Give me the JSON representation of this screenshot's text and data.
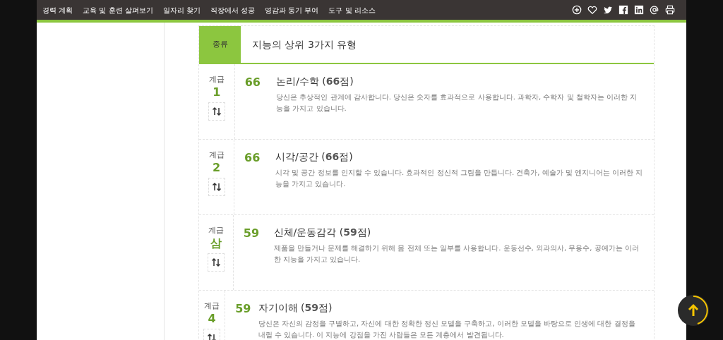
{
  "nav": {
    "items": [
      "경력 계획",
      "교육 및 훈련 살펴보기",
      "일자리 찾기",
      "직장에서 성공",
      "영감과 동기 부여",
      "도구 및 리소스"
    ],
    "icons": [
      {
        "kind": "add"
      },
      {
        "kind": "heart"
      },
      {
        "kind": "twitter"
      },
      {
        "kind": "facebook"
      },
      {
        "kind": "linkedin"
      },
      {
        "kind": "email"
      },
      {
        "kind": "print"
      }
    ]
  },
  "table": {
    "header": {
      "column_1": "종류",
      "column_2": "지능의 상위 3가지 유형"
    },
    "rows": [
      {
        "rank_label": "계급",
        "rank": "1",
        "score": "66",
        "title": "논리/수학 (**66**점)",
        "description": "당신은 추상적인 관계에 감사합니다. 당신은 숫자를 효과적으로 사용합니다. 과학자, 수학자 및 철학자는 이러한 지능을 가지고 있습니다."
      },
      {
        "rank_label": "계급",
        "rank": "2",
        "score": "66",
        "title": "시각/공간 (**66**점)",
        "description": "시각 및 공간 정보를 인지할 수 있습니다. 효과적인 정신적 그림을 만듭니다. 건축가, 예술가 및 엔지니어는 이러한 지능을 가지고 있습니다."
      },
      {
        "rank_label": "계급",
        "rank": "삼",
        "score": "59",
        "title": "신체/운동감각 (**59**점)",
        "description": "제품을 만들거나 문제를 해결하기 위해 몸 전체 또는 일부를 사용합니다. 운동선수, 외과의사, 무용수, 공예가는 이러한 지능을 가지고 있습니다."
      },
      {
        "rank_label": "계급",
        "rank": "4",
        "score": "59",
        "title": "자기이해 (**59**점)",
        "description": "당신은 자신의 감정을 구별하고, 자신에 대한 정확한 정신 모델을 구축하고, 이러한 모델을 바탕으로 인생에 대한 결정을 내릴 수 있습니다. 이 지능에 강점을 가진 사람들은 모든 계층에서 발견됩니다."
      }
    ]
  }
}
